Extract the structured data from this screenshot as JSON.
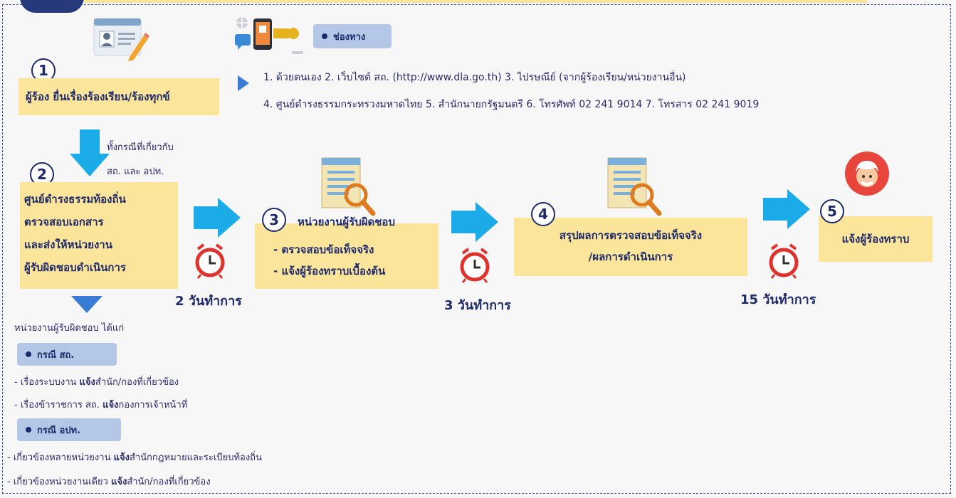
{
  "step1": {
    "num": "1",
    "text": "ผู้ร้อง ยื่นเรื่องร้องเรียน/ร้องทุกข์"
  },
  "channels": {
    "pill_label": "ช่องทาง",
    "line1": "1. ด้วยตนเอง   2. เว็บไซต์ สถ. (http://www.dla.go.th)   3. ไปรษณีย์ (จากผู้ร้องเรียน/หน่วยงานอื่น)",
    "line2": "4. ศูนย์ดำรงธรรมกระทรวงมหาดไทย    5. สำนักนายกรัฐมนตรี   6. โทรศัพท์  02 241 9014  7. โทรสาร 02 241 9019"
  },
  "arrow_note": {
    "line1": "ทั้งกรณีที่เกี่ยวกับ",
    "line2": "สถ. และ อปท."
  },
  "step2": {
    "num": "2",
    "lines": [
      "ศูนย์ดำรงธรรมท้องถิ่น",
      "ตรวจสอบเอกสาร",
      "และส่งให้หน่วยงาน",
      "ผู้รับผิดชอบดำเนินการ"
    ]
  },
  "step3": {
    "num": "3",
    "title": "หน่วยงานผู้รับผิดชอบ",
    "lines": [
      "- ตรวจสอบข้อเท็จจริง",
      "- แจ้งผู้ร้องทราบเบื้องต้น"
    ]
  },
  "step4": {
    "num": "4",
    "lines": [
      "สรุปผลการตรวจสอบข้อเท็จจริง",
      "/ผลการดำเนินการ"
    ]
  },
  "step5": {
    "num": "5",
    "text": "แจ้งผู้ร้องทราบ"
  },
  "durations": [
    "2 วันทำการ",
    "3 วันทำการ",
    "15 วันทำการ"
  ],
  "responsible": {
    "heading": "หน่วยงานผู้รับผิดชอบ ได้แก่",
    "case1": {
      "label": "กรณี สถ.",
      "items": [
        {
          "pre": "- เรื่องระบบงาน ",
          "bold": "แจ้ง",
          "post": "สำนัก/กองที่เกี่ยวข้อง"
        },
        {
          "pre": "- เรื่องข้าราชการ สถ. ",
          "bold": "แจ้ง",
          "post": "กองการเจ้าหน้าที่"
        }
      ]
    },
    "case2": {
      "label": "กรณี อปท.",
      "items": [
        {
          "pre": "- เกี่ยวข้องหลายหน่วยงาน ",
          "bold": "แจ้ง",
          "post": "สำนักกฎหมายและระเบียบท้องถิ่น"
        },
        {
          "pre": "- เกี่ยวข้องหน่วยงานเดียว ",
          "bold": "แจ้ง",
          "post": "สำนัก/กองที่เกี่ยวข้อง"
        }
      ]
    }
  },
  "icons": {
    "profile": "id-card-icon",
    "channels": "devices-icon",
    "document_search": "document-search-icon",
    "clock": "alarm-clock-icon",
    "person": "person-avatar-icon",
    "arrow": "arrow-right-icon"
  },
  "colors": {
    "yellow": "#fbe59a",
    "blue_arrow": "#1aabe8",
    "navy": "#1f2a6b",
    "pill": "#b4c7e7",
    "clock": "#e0322b"
  }
}
